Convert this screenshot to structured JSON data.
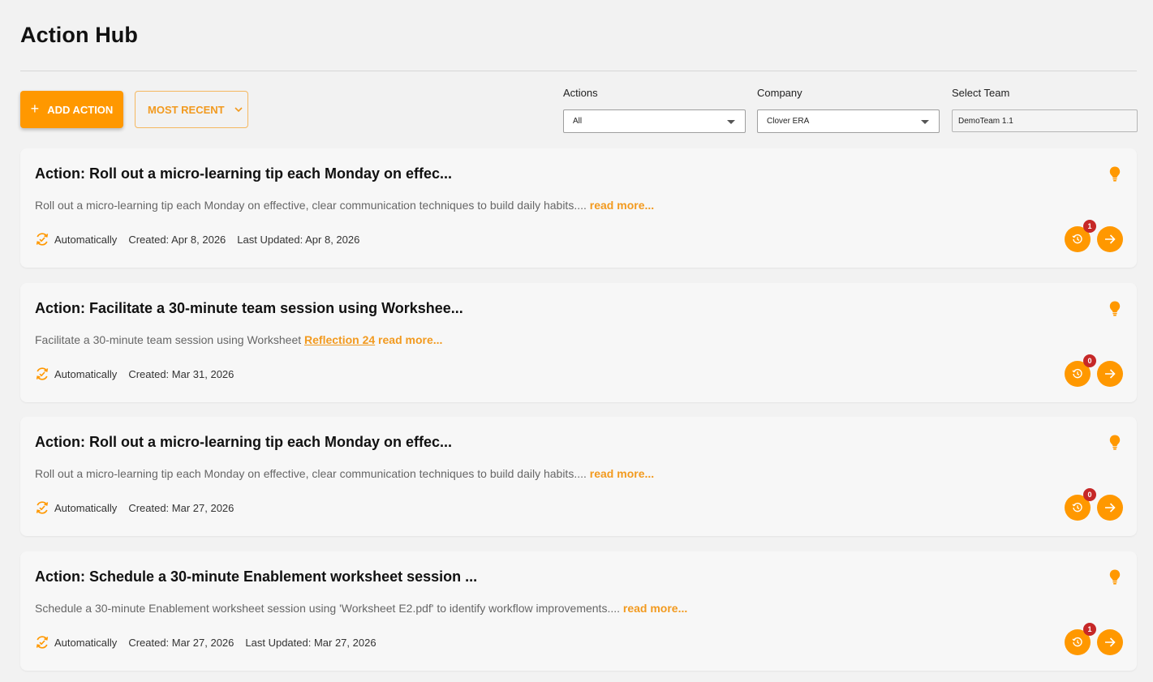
{
  "page": {
    "title": "Action Hub"
  },
  "toolbar": {
    "add_label": "ADD ACTION",
    "sort_label": "MOST RECENT"
  },
  "filters": {
    "actions": {
      "label": "Actions",
      "value": "All"
    },
    "company": {
      "label": "Company",
      "value": "Clover ERA"
    },
    "team": {
      "label": "Select Team",
      "value": "DemoTeam 1.1"
    }
  },
  "colors": {
    "accent": "#ff9800",
    "badge": "#c62828",
    "background": "#f2f2f2",
    "card": "#f7f7f7"
  },
  "icons": {
    "add": "plus-icon",
    "sort": "chevron-down-icon",
    "idea": "lightbulb-icon",
    "auto": "auto-sync-icon",
    "history": "history-icon",
    "open": "arrow-right-icon"
  },
  "cards": [
    {
      "title": "Action: Roll out a micro-learning tip each Monday on effec...",
      "desc": "Roll out a micro-learning tip each Monday on effective, clear communication techniques to build daily habits....",
      "link": "",
      "read_more": "read more...",
      "mode": "Automatically",
      "created": "Created: Apr 8, 2026",
      "updated": "Last Updated: Apr 8, 2026",
      "badge": "1"
    },
    {
      "title": "Action: Facilitate a 30-minute team session using Workshee...",
      "desc": "Facilitate a 30-minute team session using Worksheet",
      "link": "Reflection 24",
      "read_more": "read more...",
      "mode": "Automatically",
      "created": "Created: Mar 31, 2026",
      "updated": "",
      "badge": "0"
    },
    {
      "title": "Action: Roll out a micro-learning tip each Monday on effec...",
      "desc": "Roll out a micro-learning tip each Monday on effective, clear communication techniques to build daily habits....",
      "link": "",
      "read_more": "read more...",
      "mode": "Automatically",
      "created": "Created: Mar 27, 2026",
      "updated": "",
      "badge": "0"
    },
    {
      "title": "Action: Schedule a 30-minute Enablement worksheet session ...",
      "desc": "Schedule a 30-minute Enablement worksheet session using 'Worksheet E2.pdf' to identify workflow improvements....",
      "link": "",
      "read_more": "read more...",
      "mode": "Automatically",
      "created": "Created: Mar 27, 2026",
      "updated": "Last Updated: Mar 27, 2026",
      "badge": "1"
    }
  ]
}
